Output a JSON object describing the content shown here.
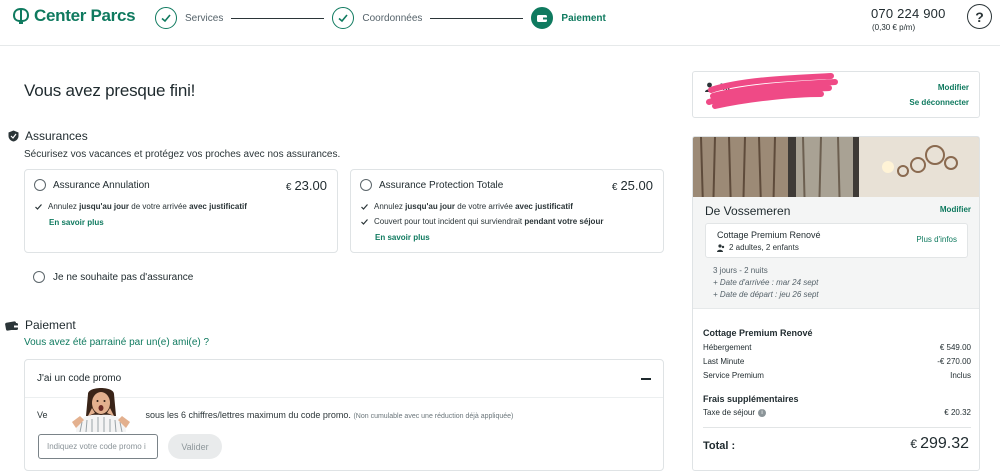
{
  "header": {
    "logo_text": "Center Parcs",
    "steps": [
      {
        "label": "Services",
        "state": "done"
      },
      {
        "label": "Coordonnées",
        "state": "done"
      },
      {
        "label": "Paiement",
        "state": "active"
      }
    ],
    "phone_number": "070 224 900",
    "phone_rate": "(0,30 € p/m)",
    "help_label": "?"
  },
  "main": {
    "title": "Vous avez presque fini!",
    "insurance": {
      "title": "Assurances",
      "subtitle": "Sécurisez vos vacances et protégez vos proches avec nos assurances.",
      "options": [
        {
          "name": "Assurance Annulation",
          "currency": "€",
          "price": "23.00",
          "lines": [
            {
              "pre": "Annulez ",
              "b1": "jusqu'au jour",
              "mid": " de votre arrivée ",
              "b2": "avec justificatif"
            }
          ],
          "learn_more": "En savoir plus"
        },
        {
          "name": "Assurance Protection Totale",
          "currency": "€",
          "price": "25.00",
          "lines": [
            {
              "pre": "Annulez ",
              "b1": "jusqu'au jour",
              "mid": " de votre arrivée ",
              "b2": "avec justificatif"
            },
            {
              "pre": "Couvert pour tout incident qui surviendrait ",
              "b1": "pendant votre séjour",
              "mid": "",
              "b2": ""
            }
          ],
          "learn_more": "En savoir plus"
        }
      ],
      "no_insurance": "Je ne souhaite pas d'assurance"
    },
    "payment": {
      "title": "Paiement",
      "sponsor_link": "Vous avez été parrainé par un(e) ami(e) ?",
      "promo": {
        "header": "J'ai un code promo",
        "text_start": "Ve",
        "text_main": "sous les 6 chiffres/lettres maximum du code promo.",
        "text_note": "(Non cumulable avec une réduction déjà appliquée)",
        "input_placeholder": "Indiquez votre code promo i",
        "button_label": "Valider"
      }
    }
  },
  "sidebar": {
    "user": {
      "name": "Mr",
      "modify_link": "Modifier",
      "logout_link": "Se déconnecter"
    },
    "stay": {
      "place": "De Vossemeren",
      "modify_link": "Modifier",
      "accommodation": "Cottage Premium Renové",
      "guests": "2 adultes, 2 enfants",
      "more_info": "Plus d'infos",
      "duration": "3 jours - 2 nuits",
      "arrival": "+ Date d'arrivée : mar 24 sept",
      "departure": "+ Date de départ : jeu 26 sept"
    },
    "pricing": {
      "accommodation_title": "Cottage Premium Renové",
      "rows": [
        {
          "label": "Hébergement",
          "value": "€ 549.00"
        },
        {
          "label": "Last Minute",
          "value": "-€ 270.00"
        },
        {
          "label": "Service Premium",
          "value": "Inclus"
        }
      ],
      "extra_title": "Frais supplémentaires",
      "tax_label": "Taxe de séjour",
      "tax_value": "€ 20.32",
      "total_label": "Total :",
      "total_currency": "€",
      "total_value": "299.32"
    }
  },
  "colors": {
    "brand": "#0f7a5f",
    "text": "#1f2a2e",
    "border": "#dfe3e5",
    "scribble": "#ef4a86"
  }
}
